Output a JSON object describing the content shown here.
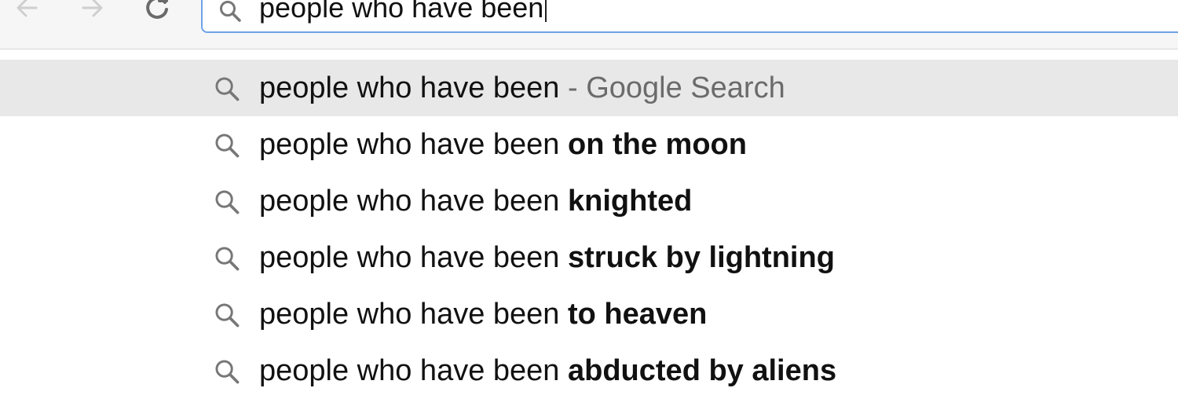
{
  "toolbar": {
    "back_icon": "arrow-left-icon",
    "forward_icon": "arrow-right-icon",
    "reload_icon": "reload-icon"
  },
  "omnibox": {
    "icon": "search-icon",
    "value": "people who have been"
  },
  "colors": {
    "omnibox_border": "#6ea3e8",
    "selected_row": "#e8e8e8",
    "hint_text": "#6b6b6b"
  },
  "suggestions": [
    {
      "icon": "search-icon",
      "prefix": "people who have been",
      "suffix": "",
      "hint": " - Google Search",
      "selected": true
    },
    {
      "icon": "search-icon",
      "prefix": "people who have been ",
      "suffix": "on the moon",
      "hint": ""
    },
    {
      "icon": "search-icon",
      "prefix": "people who have been ",
      "suffix": "knighted",
      "hint": ""
    },
    {
      "icon": "search-icon",
      "prefix": "people who have been ",
      "suffix": "struck by lightning",
      "hint": ""
    },
    {
      "icon": "search-icon",
      "prefix": "people who have been ",
      "suffix": "to heaven",
      "hint": ""
    },
    {
      "icon": "search-icon",
      "prefix": "people who have been ",
      "suffix": "abducted by aliens",
      "hint": ""
    }
  ]
}
